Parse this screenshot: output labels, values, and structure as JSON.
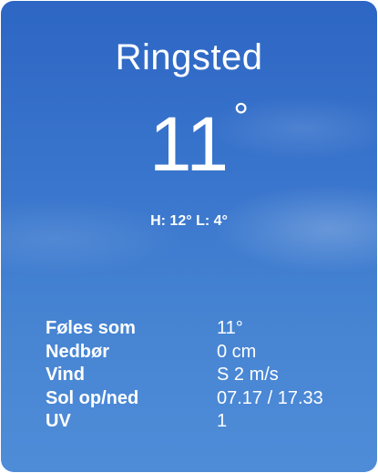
{
  "location": {
    "city": "Ringsted"
  },
  "current": {
    "temperature": "11",
    "degree_symbol": "°",
    "high_low": "H: 12°  L: 4°"
  },
  "details": [
    {
      "label": "Føles som",
      "value": "11°"
    },
    {
      "label": "Nedbør",
      "value": "0 cm"
    },
    {
      "label": "Vind",
      "value": "S 2 m/s"
    },
    {
      "label": "Sol op/ned",
      "value": "07.17 / 17.33"
    },
    {
      "label": "UV",
      "value": "1"
    }
  ],
  "colors": {
    "sky_top": "#2d66c4",
    "sky_bottom": "#4f8cd8",
    "text": "#ffffff"
  }
}
